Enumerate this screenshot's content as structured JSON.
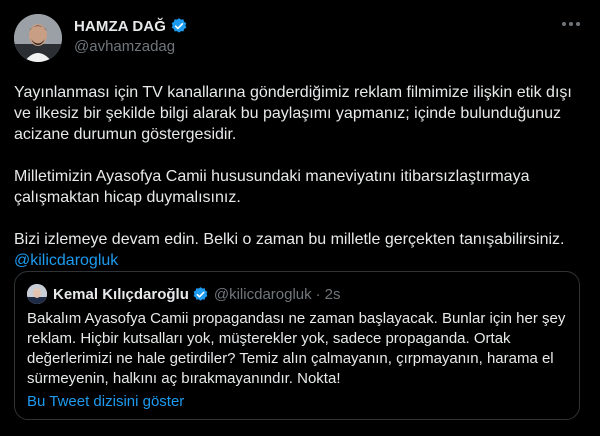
{
  "author": {
    "name": "HAMZA DAĞ",
    "handle": "@avhamzadag"
  },
  "tweet": {
    "paragraph1": "Yayınlanması için TV kanallarına gönderdiğimiz reklam filmimize ilişkin etik dışı ve ilkesiz bir şekilde bilgi alarak bu paylaşımı yapmanız; içinde bulunduğunuz acizane durumun göstergesidir.",
    "paragraph2": "Milletimizin Ayasofya Camii hususundaki maneviyatını itibarsızlaştırmaya çalışmaktan hicap duymalısınız.",
    "paragraph3_text": "Bizi izlemeye devam edin. Belki o zaman bu milletle gerçekten tanışabilirsiniz. ",
    "paragraph3_mention": "@kilicdarogluk"
  },
  "quoted": {
    "name": "Kemal Kılıçdaroğlu",
    "handle": "@kilicdarogluk",
    "separator": "·",
    "time": "2s",
    "text": "Bakalım Ayasofya Camii propagandası ne zaman başlayacak. Bunlar için her şey reklam. Hiçbir kutsalları yok, müşterekler yok, sadece propaganda. Ortak değerlerimizi ne hale getirdiler? Temiz alın çalmayanın, çırpmayanın, harama el sürmeyenin, halkını aç bırakmayanındır. Nokta!",
    "show_thread": "Bu Tweet dizisini göster"
  },
  "colors": {
    "background": "#000000",
    "text": "#e7e9ea",
    "secondary": "#71767b",
    "accent": "#1d9bf0",
    "border": "#2f3336"
  },
  "icons": [
    "verified-badge-icon",
    "more-options-icon"
  ]
}
